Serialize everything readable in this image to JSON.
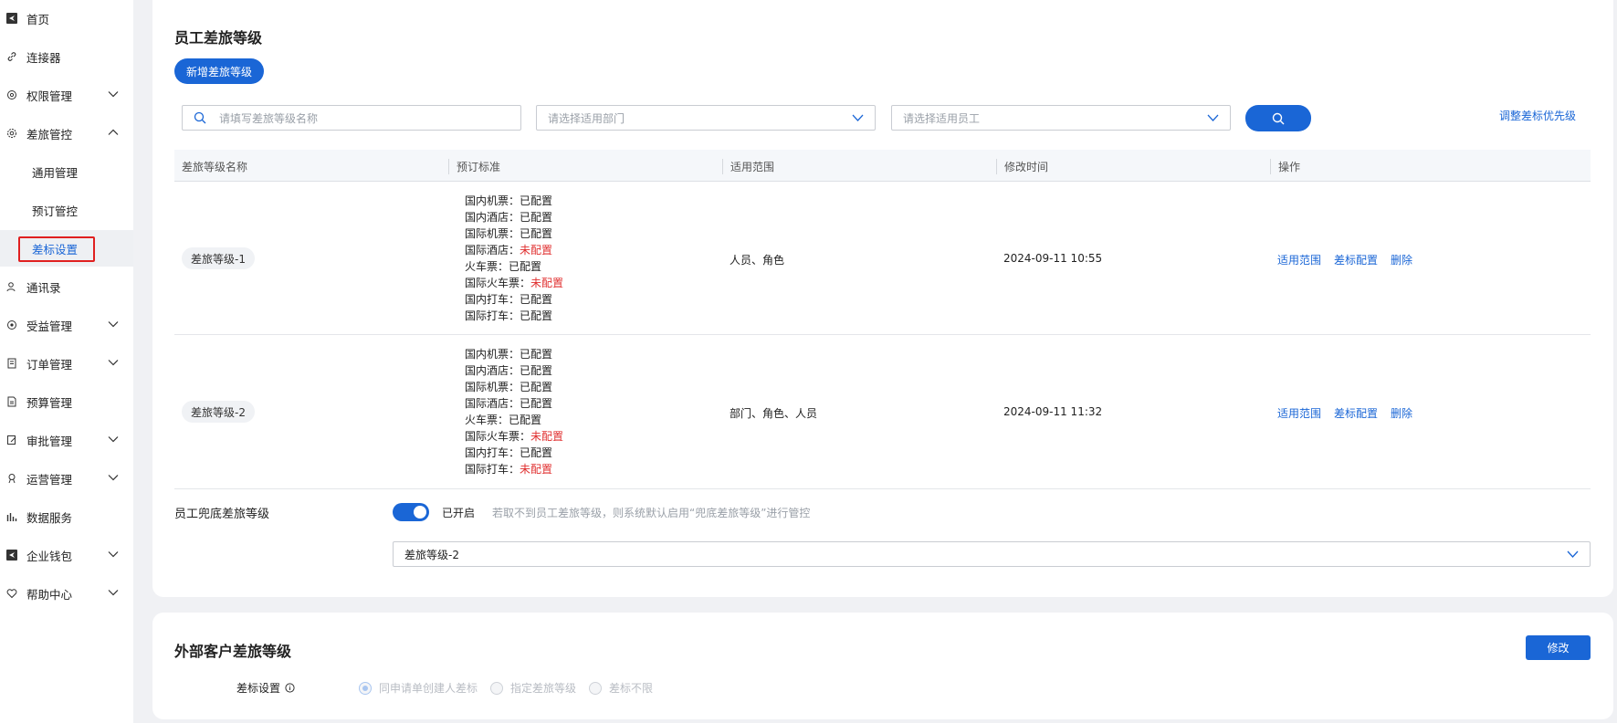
{
  "sidebar": {
    "items": [
      {
        "label": "首页",
        "icon": "plane-icon"
      },
      {
        "label": "连接器",
        "icon": "link-icon"
      },
      {
        "label": "权限管理",
        "icon": "shield-icon"
      },
      {
        "label": "差旅管控",
        "icon": "gear-icon"
      },
      {
        "label": "通用管理"
      },
      {
        "label": "预订管控"
      },
      {
        "label": "差标设置"
      },
      {
        "label": "通讯录",
        "icon": "contacts-icon"
      },
      {
        "label": "受益管理",
        "icon": "target-icon"
      },
      {
        "label": "订单管理",
        "icon": "document-icon"
      },
      {
        "label": "预算管理",
        "icon": "budget-icon"
      },
      {
        "label": "审批管理",
        "icon": "edit-icon"
      },
      {
        "label": "运营管理",
        "icon": "operations-icon"
      },
      {
        "label": "数据服务",
        "icon": "bar-chart-icon"
      },
      {
        "label": "企业钱包",
        "icon": "wallet-icon"
      },
      {
        "label": "帮助中心",
        "icon": "heart-icon"
      }
    ]
  },
  "employee": {
    "title": "员工差旅等级",
    "add_button": "新增差旅等级",
    "search_placeholder": "请填写差旅等级名称",
    "dept_placeholder": "请选择适用部门",
    "staff_placeholder": "请选择适用员工",
    "priority_link": "调整差标优先级",
    "columns": [
      "差旅等级名称",
      "预订标准",
      "适用范围",
      "修改时间",
      "操作"
    ],
    "rows": [
      {
        "name": "差旅等级-1",
        "standards": [
          {
            "k": "国内机票：",
            "v": "已配置"
          },
          {
            "k": "国内酒店：",
            "v": "已配置"
          },
          {
            "k": "国际机票：",
            "v": "已配置"
          },
          {
            "k": "国际酒店：",
            "v": "未配置"
          },
          {
            "k": "火车票：",
            "v": "已配置"
          },
          {
            "k": "国际火车票：",
            "v": "未配置"
          },
          {
            "k": "国内打车：",
            "v": "已配置"
          },
          {
            "k": "国际打车：",
            "v": "已配置"
          }
        ],
        "scope": "人员、角色",
        "time": "2024-09-11 10:55",
        "ops": [
          "适用范围",
          "差标配置",
          "删除"
        ]
      },
      {
        "name": "差旅等级-2",
        "standards": [
          {
            "k": "国内机票：",
            "v": "已配置"
          },
          {
            "k": "国内酒店：",
            "v": "已配置"
          },
          {
            "k": "国际机票：",
            "v": "已配置"
          },
          {
            "k": "国际酒店：",
            "v": "已配置"
          },
          {
            "k": "火车票：",
            "v": "已配置"
          },
          {
            "k": "国际火车票：",
            "v": "未配置"
          },
          {
            "k": "国内打车：",
            "v": "已配置"
          },
          {
            "k": "国际打车：",
            "v": "未配置"
          }
        ],
        "scope": "部门、角色、人员",
        "time": "2024-09-11 11:32",
        "ops": [
          "适用范围",
          "差标配置",
          "删除"
        ]
      }
    ],
    "fallback": {
      "label": "员工兜底差旅等级",
      "toggle_on": true,
      "status": "已开启",
      "hint": "若取不到员工差旅等级，则系统默认启用“兜底差旅等级”进行管控",
      "selected": "差旅等级-2"
    }
  },
  "external": {
    "title": "外部客户差旅等级",
    "edit_button": "修改",
    "setting_label": "差标设置",
    "options": [
      {
        "label": "同申请单创建人差标",
        "checked": true
      },
      {
        "label": "指定差旅等级",
        "checked": false
      },
      {
        "label": "差标不限",
        "checked": false
      }
    ]
  },
  "colors": {
    "accent": "#1a66d6",
    "danger": "#e03030",
    "highlight_box": "#e02020"
  }
}
